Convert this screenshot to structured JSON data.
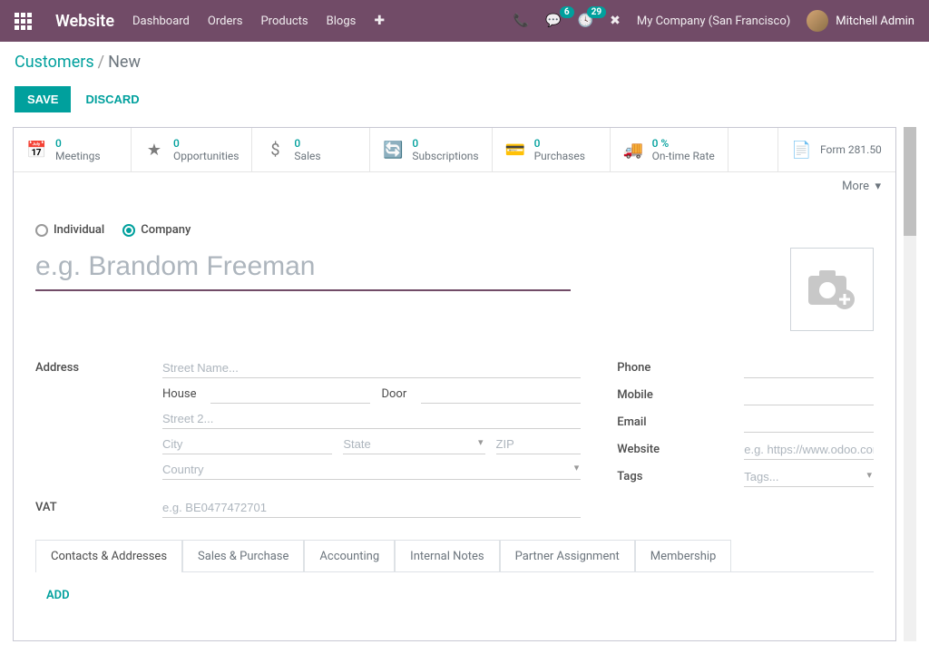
{
  "navbar": {
    "brand": "Website",
    "links": [
      "Dashboard",
      "Orders",
      "Products",
      "Blogs"
    ],
    "messages_badge": "6",
    "activities_badge": "29",
    "company": "My Company (San Francisco)",
    "user": "Mitchell Admin"
  },
  "breadcrumb": {
    "parent": "Customers",
    "current": "New"
  },
  "actions": {
    "save": "SAVE",
    "discard": "DISCARD"
  },
  "stats": {
    "meetings": {
      "value": "0",
      "label": "Meetings"
    },
    "opportunities": {
      "value": "0",
      "label": "Opportunities"
    },
    "sales": {
      "value": "0",
      "label": "Sales"
    },
    "subscriptions": {
      "value": "0",
      "label": "Subscriptions"
    },
    "purchases": {
      "value": "0",
      "label": "Purchases"
    },
    "ontime": {
      "value": "0 %",
      "label": "On-time Rate"
    },
    "form": {
      "label": "Form 281.50"
    },
    "more": "More"
  },
  "form": {
    "type_individual": "Individual",
    "type_company": "Company",
    "name_placeholder": "e.g. Brandom Freeman",
    "address_label": "Address",
    "street_placeholder": "Street Name...",
    "house_label": "House",
    "door_label": "Door",
    "street2_placeholder": "Street 2...",
    "city_placeholder": "City",
    "state_placeholder": "State",
    "zip_placeholder": "ZIP",
    "country_placeholder": "Country",
    "vat_label": "VAT",
    "vat_placeholder": "e.g. BE0477472701",
    "phone_label": "Phone",
    "mobile_label": "Mobile",
    "email_label": "Email",
    "website_label": "Website",
    "website_placeholder": "e.g. https://www.odoo.com",
    "tags_label": "Tags",
    "tags_placeholder": "Tags..."
  },
  "tabs": {
    "items": [
      "Contacts & Addresses",
      "Sales & Purchase",
      "Accounting",
      "Internal Notes",
      "Partner Assignment",
      "Membership"
    ],
    "add": "ADD"
  }
}
